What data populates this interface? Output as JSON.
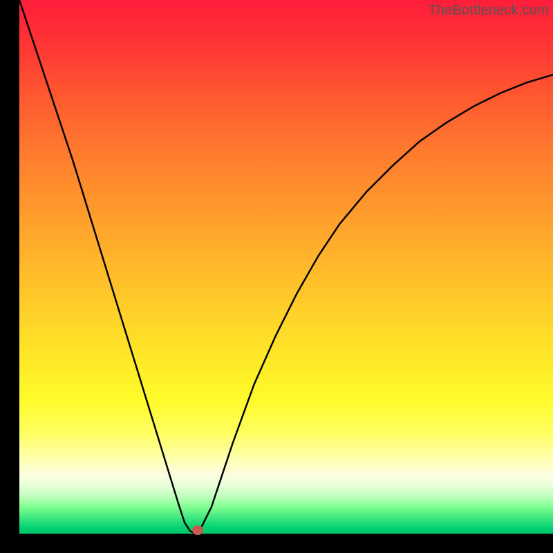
{
  "watermark": "TheBottleneck.com",
  "chart_data": {
    "type": "line",
    "title": "",
    "xlabel": "",
    "ylabel": "",
    "xlim": [
      0,
      100
    ],
    "ylim": [
      0,
      100
    ],
    "grid": false,
    "legend": false,
    "background": "rainbow-gradient",
    "x": [
      0,
      2,
      4,
      6,
      8,
      10,
      12,
      14,
      16,
      18,
      20,
      22,
      24,
      26,
      28,
      30,
      31,
      32,
      33,
      34,
      36,
      38,
      40,
      44,
      48,
      52,
      56,
      60,
      65,
      70,
      75,
      80,
      85,
      90,
      95,
      100
    ],
    "values": [
      100,
      94,
      88,
      82,
      76,
      70,
      63.5,
      57,
      50.5,
      44,
      37.5,
      31,
      24.5,
      18,
      11.5,
      5,
      2,
      0.5,
      0,
      1,
      5,
      11,
      17,
      28,
      37,
      45,
      52,
      58,
      64,
      69,
      73.5,
      77,
      80,
      82.5,
      84.5,
      86
    ],
    "marker_point": {
      "x": 33,
      "y": 0
    },
    "colors": {
      "line": "#000000",
      "marker": "#c45b52",
      "frame": "#000000"
    }
  }
}
